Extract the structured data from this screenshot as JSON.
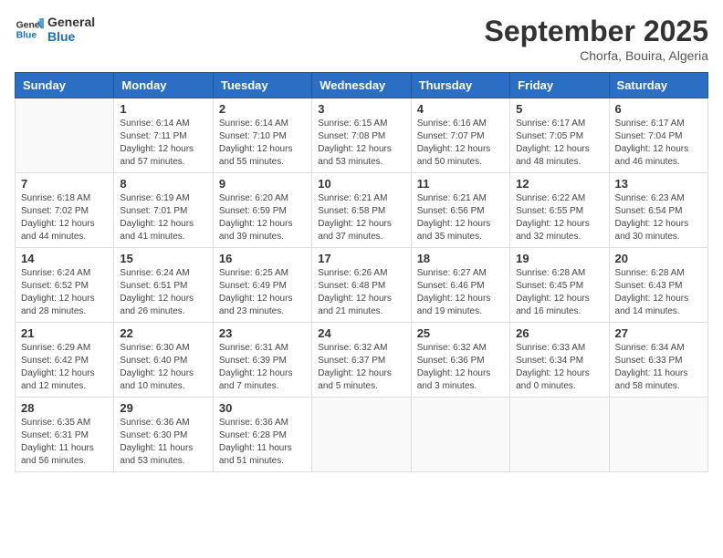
{
  "header": {
    "logo_line1": "General",
    "logo_line2": "Blue",
    "month_year": "September 2025",
    "location": "Chorfa, Bouira, Algeria"
  },
  "weekdays": [
    "Sunday",
    "Monday",
    "Tuesday",
    "Wednesday",
    "Thursday",
    "Friday",
    "Saturday"
  ],
  "weeks": [
    [
      {
        "day": "",
        "sunrise": "",
        "sunset": "",
        "daylight": ""
      },
      {
        "day": "1",
        "sunrise": "Sunrise: 6:14 AM",
        "sunset": "Sunset: 7:11 PM",
        "daylight": "Daylight: 12 hours and 57 minutes."
      },
      {
        "day": "2",
        "sunrise": "Sunrise: 6:14 AM",
        "sunset": "Sunset: 7:10 PM",
        "daylight": "Daylight: 12 hours and 55 minutes."
      },
      {
        "day": "3",
        "sunrise": "Sunrise: 6:15 AM",
        "sunset": "Sunset: 7:08 PM",
        "daylight": "Daylight: 12 hours and 53 minutes."
      },
      {
        "day": "4",
        "sunrise": "Sunrise: 6:16 AM",
        "sunset": "Sunset: 7:07 PM",
        "daylight": "Daylight: 12 hours and 50 minutes."
      },
      {
        "day": "5",
        "sunrise": "Sunrise: 6:17 AM",
        "sunset": "Sunset: 7:05 PM",
        "daylight": "Daylight: 12 hours and 48 minutes."
      },
      {
        "day": "6",
        "sunrise": "Sunrise: 6:17 AM",
        "sunset": "Sunset: 7:04 PM",
        "daylight": "Daylight: 12 hours and 46 minutes."
      }
    ],
    [
      {
        "day": "7",
        "sunrise": "Sunrise: 6:18 AM",
        "sunset": "Sunset: 7:02 PM",
        "daylight": "Daylight: 12 hours and 44 minutes."
      },
      {
        "day": "8",
        "sunrise": "Sunrise: 6:19 AM",
        "sunset": "Sunset: 7:01 PM",
        "daylight": "Daylight: 12 hours and 41 minutes."
      },
      {
        "day": "9",
        "sunrise": "Sunrise: 6:20 AM",
        "sunset": "Sunset: 6:59 PM",
        "daylight": "Daylight: 12 hours and 39 minutes."
      },
      {
        "day": "10",
        "sunrise": "Sunrise: 6:21 AM",
        "sunset": "Sunset: 6:58 PM",
        "daylight": "Daylight: 12 hours and 37 minutes."
      },
      {
        "day": "11",
        "sunrise": "Sunrise: 6:21 AM",
        "sunset": "Sunset: 6:56 PM",
        "daylight": "Daylight: 12 hours and 35 minutes."
      },
      {
        "day": "12",
        "sunrise": "Sunrise: 6:22 AM",
        "sunset": "Sunset: 6:55 PM",
        "daylight": "Daylight: 12 hours and 32 minutes."
      },
      {
        "day": "13",
        "sunrise": "Sunrise: 6:23 AM",
        "sunset": "Sunset: 6:54 PM",
        "daylight": "Daylight: 12 hours and 30 minutes."
      }
    ],
    [
      {
        "day": "14",
        "sunrise": "Sunrise: 6:24 AM",
        "sunset": "Sunset: 6:52 PM",
        "daylight": "Daylight: 12 hours and 28 minutes."
      },
      {
        "day": "15",
        "sunrise": "Sunrise: 6:24 AM",
        "sunset": "Sunset: 6:51 PM",
        "daylight": "Daylight: 12 hours and 26 minutes."
      },
      {
        "day": "16",
        "sunrise": "Sunrise: 6:25 AM",
        "sunset": "Sunset: 6:49 PM",
        "daylight": "Daylight: 12 hours and 23 minutes."
      },
      {
        "day": "17",
        "sunrise": "Sunrise: 6:26 AM",
        "sunset": "Sunset: 6:48 PM",
        "daylight": "Daylight: 12 hours and 21 minutes."
      },
      {
        "day": "18",
        "sunrise": "Sunrise: 6:27 AM",
        "sunset": "Sunset: 6:46 PM",
        "daylight": "Daylight: 12 hours and 19 minutes."
      },
      {
        "day": "19",
        "sunrise": "Sunrise: 6:28 AM",
        "sunset": "Sunset: 6:45 PM",
        "daylight": "Daylight: 12 hours and 16 minutes."
      },
      {
        "day": "20",
        "sunrise": "Sunrise: 6:28 AM",
        "sunset": "Sunset: 6:43 PM",
        "daylight": "Daylight: 12 hours and 14 minutes."
      }
    ],
    [
      {
        "day": "21",
        "sunrise": "Sunrise: 6:29 AM",
        "sunset": "Sunset: 6:42 PM",
        "daylight": "Daylight: 12 hours and 12 minutes."
      },
      {
        "day": "22",
        "sunrise": "Sunrise: 6:30 AM",
        "sunset": "Sunset: 6:40 PM",
        "daylight": "Daylight: 12 hours and 10 minutes."
      },
      {
        "day": "23",
        "sunrise": "Sunrise: 6:31 AM",
        "sunset": "Sunset: 6:39 PM",
        "daylight": "Daylight: 12 hours and 7 minutes."
      },
      {
        "day": "24",
        "sunrise": "Sunrise: 6:32 AM",
        "sunset": "Sunset: 6:37 PM",
        "daylight": "Daylight: 12 hours and 5 minutes."
      },
      {
        "day": "25",
        "sunrise": "Sunrise: 6:32 AM",
        "sunset": "Sunset: 6:36 PM",
        "daylight": "Daylight: 12 hours and 3 minutes."
      },
      {
        "day": "26",
        "sunrise": "Sunrise: 6:33 AM",
        "sunset": "Sunset: 6:34 PM",
        "daylight": "Daylight: 12 hours and 0 minutes."
      },
      {
        "day": "27",
        "sunrise": "Sunrise: 6:34 AM",
        "sunset": "Sunset: 6:33 PM",
        "daylight": "Daylight: 11 hours and 58 minutes."
      }
    ],
    [
      {
        "day": "28",
        "sunrise": "Sunrise: 6:35 AM",
        "sunset": "Sunset: 6:31 PM",
        "daylight": "Daylight: 11 hours and 56 minutes."
      },
      {
        "day": "29",
        "sunrise": "Sunrise: 6:36 AM",
        "sunset": "Sunset: 6:30 PM",
        "daylight": "Daylight: 11 hours and 53 minutes."
      },
      {
        "day": "30",
        "sunrise": "Sunrise: 6:36 AM",
        "sunset": "Sunset: 6:28 PM",
        "daylight": "Daylight: 11 hours and 51 minutes."
      },
      {
        "day": "",
        "sunrise": "",
        "sunset": "",
        "daylight": ""
      },
      {
        "day": "",
        "sunrise": "",
        "sunset": "",
        "daylight": ""
      },
      {
        "day": "",
        "sunrise": "",
        "sunset": "",
        "daylight": ""
      },
      {
        "day": "",
        "sunrise": "",
        "sunset": "",
        "daylight": ""
      }
    ]
  ]
}
